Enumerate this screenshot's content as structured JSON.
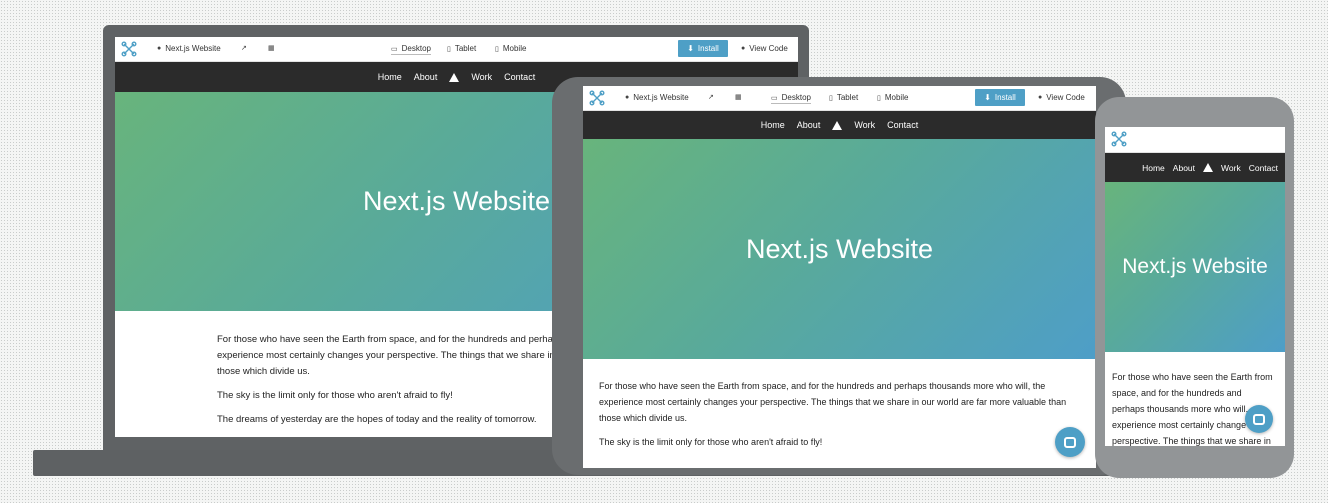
{
  "toolbar": {
    "site_name": "Next.js Website",
    "desktop": "Desktop",
    "tablet": "Tablet",
    "mobile": "Mobile",
    "install": "Install",
    "view_code": "View Code"
  },
  "nav": {
    "items": [
      "Home",
      "About",
      "Work",
      "Contact"
    ]
  },
  "hero": {
    "title": "Next.js Website"
  },
  "content": {
    "laptop": {
      "p1": "For those who have seen the Earth from space, and for the hundreds and perhaps th",
      "p1b": "experience most certainly changes your perspective. The things that we share in our",
      "p1c": "those which divide us.",
      "p2": "The sky is the limit only for those who aren't afraid to fly!",
      "p3": "The dreams of yesterday are the hopes of today and the reality of tomorrow."
    },
    "tablet": {
      "p1a": "For those who have seen the Earth from space, and for the hundreds and perhaps thousands more who will, the",
      "p1b": "experience most certainly changes your perspective. The things that we share in our world are far more valuable than",
      "p1c": "those which divide us.",
      "p2": "The sky is the limit only for those who aren't afraid to fly!"
    },
    "phone": {
      "l1": "For those who have seen the Earth from",
      "l2": "space, and for the hundreds and",
      "l3": "perhaps thousands more who will,",
      "l4": "experience most certainly change",
      "l5": "perspective. The things that we share in"
    }
  },
  "colors": {
    "accent": "#4e9fc6",
    "navbar": "#2b2b2b",
    "hero_start": "#68b47c",
    "hero_end": "#4e9ec8"
  }
}
